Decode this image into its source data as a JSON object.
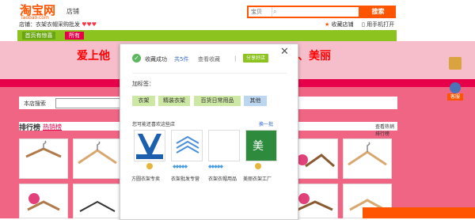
{
  "header": {
    "logo_cn": "淘宝网",
    "logo_en": "Taobao.com",
    "shop_name": "店铺",
    "search_scope": "宝贝",
    "search_placeholder": "",
    "search_button": "搜索"
  },
  "shopbar": {
    "left_text": "店铺：衣架衣帽采购批发",
    "hearts": "♥♥♥",
    "right_links": [
      "收藏店铺",
      "用手机打开"
    ]
  },
  "nav": {
    "items": [
      "首页有惊喜",
      "所有"
    ]
  },
  "banner": {
    "text_left": "爱上他",
    "text_right": "、美丽"
  },
  "filter": {
    "label": "本店搜索"
  },
  "ranking": {
    "title": "排行榜",
    "tab": "热销榜",
    "right_text": "查看热销排行榜"
  },
  "popup": {
    "fav_status": "收藏成功",
    "fav_link": "共5件",
    "fav_mid": "查看收藏",
    "fav_badge": "分享好店",
    "tags_title": "加标签：",
    "tags": [
      "衣架",
      "精装衣架",
      "百货日常用品",
      "其他"
    ],
    "recs_title": "您可能还喜欢这些店",
    "recs_more": "换一批",
    "recs": [
      {
        "label": "方圆衣架专卖",
        "logo": "MY",
        "crown": "crown-icon"
      },
      {
        "label": "衣架批发专营",
        "logo": "",
        "crown": "diamond-icon"
      },
      {
        "label": "衣架衣帽用品",
        "logo": "",
        "crown": "diamond-icon"
      },
      {
        "label": "美丽衣架工厂",
        "logo": "美",
        "crown": "crown-icon"
      }
    ]
  },
  "sidebar": {
    "badge": "客服"
  },
  "colors": {
    "orange": "#ff5500",
    "green": "#8cc31f",
    "pink_light": "#f6bdcb",
    "pink_dark": "#e6004a",
    "pink_mid": "#f06584"
  }
}
